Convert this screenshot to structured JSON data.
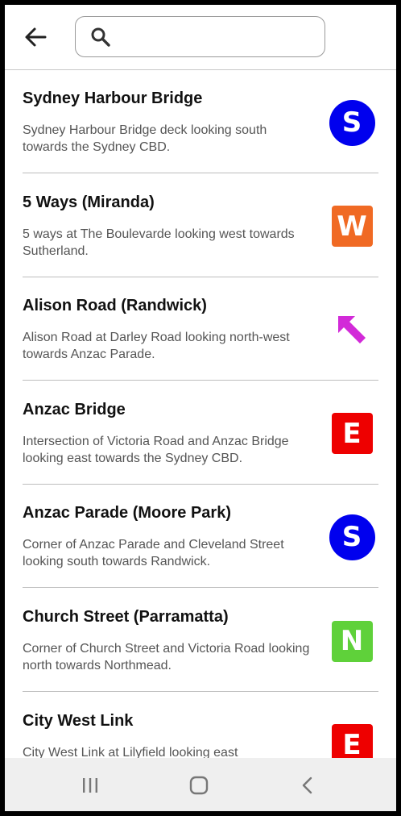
{
  "search": {
    "value": "",
    "placeholder": ""
  },
  "colors": {
    "blue": "#0000ee",
    "orange": "#f06a24",
    "magenta": "#d22ad8",
    "red": "#ee0000",
    "green": "#5fd13a"
  },
  "items": [
    {
      "title": "Sydney Harbour Bridge",
      "description": "Sydney Harbour Bridge deck looking south towards the Sydney CBD.",
      "badge": {
        "kind": "circle",
        "letter": "S",
        "direction": "south",
        "color": "#0000ee"
      }
    },
    {
      "title": "5 Ways (Miranda)",
      "description": "5 ways at The Boulevarde looking west towards Sutherland.",
      "badge": {
        "kind": "square",
        "letter": "W",
        "direction": "west",
        "color": "#f06a24"
      }
    },
    {
      "title": "Alison Road (Randwick)",
      "description": "Alison Road at Darley Road looking north-west towards Anzac Parade.",
      "badge": {
        "kind": "arrow",
        "direction": "north-west",
        "color": "#d22ad8"
      }
    },
    {
      "title": "Anzac Bridge",
      "description": "Intersection of Victoria Road and Anzac Bridge looking east towards the Sydney CBD.",
      "badge": {
        "kind": "square",
        "letter": "E",
        "direction": "east",
        "color": "#ee0000"
      }
    },
    {
      "title": "Anzac Parade (Moore Park)",
      "description": "Corner of Anzac Parade and Cleveland Street looking south towards Randwick.",
      "badge": {
        "kind": "circle",
        "letter": "S",
        "direction": "south",
        "color": "#0000ee"
      }
    },
    {
      "title": "Church Street (Parramatta)",
      "description": "Corner of Church Street and Victoria Road looking north towards Northmead.",
      "badge": {
        "kind": "square",
        "letter": "N",
        "direction": "north",
        "color": "#5fd13a"
      }
    },
    {
      "title": "City West Link",
      "description": "City West Link at Lilyfield looking east",
      "badge": {
        "kind": "square",
        "letter": "E",
        "direction": "east",
        "color": "#ee0000"
      }
    }
  ],
  "icons": {
    "back": "arrow-left-icon",
    "search": "search-icon",
    "recents": "recents-icon",
    "home": "home-icon",
    "nav_back": "chevron-left-icon"
  }
}
